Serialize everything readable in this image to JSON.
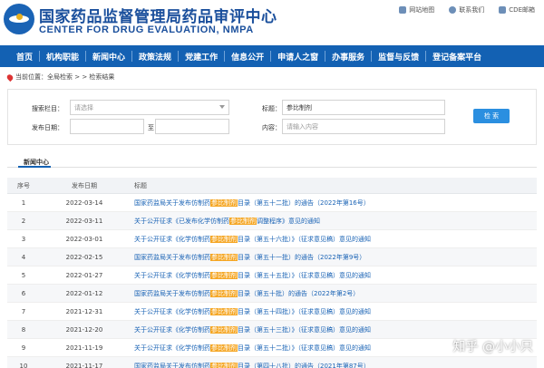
{
  "header": {
    "site_name_cn": "国家药品监督管理局药品审评中心",
    "site_name_en": "CENTER FOR DRUG EVALUATION, NMPA",
    "top_links": [
      {
        "label": "网站地图",
        "icon": "sitemap-icon"
      },
      {
        "label": "联系我们",
        "icon": "contact-icon"
      },
      {
        "label": "CDE邮箱",
        "icon": "mail-icon"
      }
    ]
  },
  "nav": {
    "items": [
      "首页",
      "机构职能",
      "新闻中心",
      "政策法规",
      "党建工作",
      "信息公开",
      "申请人之窗",
      "办事服务",
      "监督与反馈",
      "登记备案平台"
    ]
  },
  "breadcrumb": {
    "text": "当前位置：全局检索 > > 检索结果"
  },
  "search": {
    "column_label": "搜索栏目：",
    "column_placeholder": "请选择",
    "title_label": "标题：",
    "title_value": "参比制剂",
    "date_label": "发布日期：",
    "date_separator": "至",
    "content_label": "内容：",
    "content_placeholder": "请输入内容",
    "button_label": "检 索"
  },
  "section": {
    "title": "新闻中心"
  },
  "table": {
    "headers": {
      "no": "序号",
      "date": "发布日期",
      "title": "标题"
    },
    "rows": [
      {
        "no": "1",
        "date": "2022-03-14",
        "pre": "国家药监局关于发布仿制药",
        "hl": "参比制剂",
        "post": "目录（第五十二批）的通告（2022年第16号）"
      },
      {
        "no": "2",
        "date": "2022-03-11",
        "pre": "关于公开征求《已发布化学仿制药",
        "hl": "参比制剂",
        "post": "调整程序》意见的通知"
      },
      {
        "no": "3",
        "date": "2022-03-01",
        "pre": "关于公开征求《化学仿制药",
        "hl": "参比制剂",
        "post": "目录（第五十六批）》（征求意见稿）意见的通知"
      },
      {
        "no": "4",
        "date": "2022-02-15",
        "pre": "国家药监局关于发布仿制药",
        "hl": "参比制剂",
        "post": "目录（第五十一批）的通告（2022年第9号）"
      },
      {
        "no": "5",
        "date": "2022-01-27",
        "pre": "关于公开征求《化学仿制药",
        "hl": "参比制剂",
        "post": "目录（第五十五批）》（征求意见稿）意见的通知"
      },
      {
        "no": "6",
        "date": "2022-01-12",
        "pre": "国家药监局关于发布仿制药",
        "hl": "参比制剂",
        "post": "目录（第五十批）的通告（2022年第2号）"
      },
      {
        "no": "7",
        "date": "2021-12-31",
        "pre": "关于公开征求《化学仿制药",
        "hl": "参比制剂",
        "post": "目录（第五十四批）》（征求意见稿）意见的通知"
      },
      {
        "no": "8",
        "date": "2021-12-20",
        "pre": "关于公开征求《化学仿制药",
        "hl": "参比制剂",
        "post": "目录（第五十三批）》（征求意见稿）意见的通知"
      },
      {
        "no": "9",
        "date": "2021-11-19",
        "pre": "关于公开征求《化学仿制药",
        "hl": "参比制剂",
        "post": "目录（第五十二批）》（征求意见稿）意见的通知"
      },
      {
        "no": "10",
        "date": "2021-11-17",
        "pre": "国家药监局关于发布仿制药",
        "hl": "参比制剂",
        "post": "目录（第四十八批）的通告（2021年第87号）"
      }
    ]
  },
  "watermark": "知乎 @小小只",
  "colors": {
    "brand_blue": "#1361b3",
    "highlight": "#f5a623",
    "link": "#1a63b5",
    "button": "#2b8fe0"
  }
}
